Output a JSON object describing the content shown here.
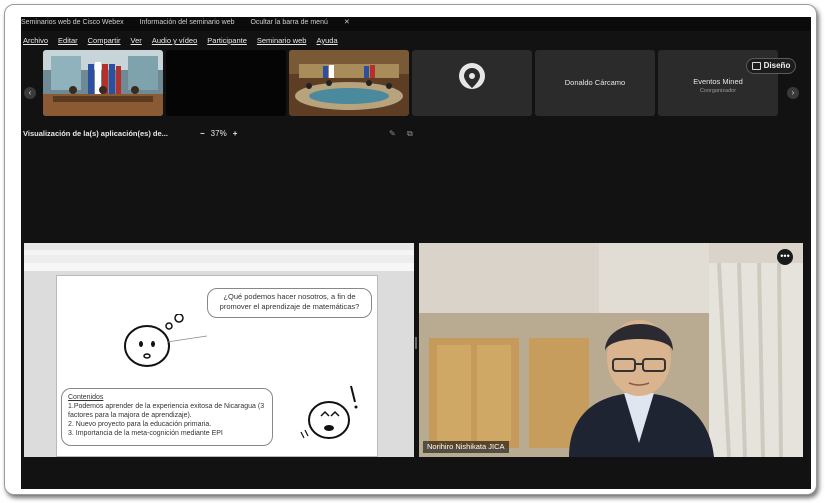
{
  "top_strip": {
    "items": [
      "Seminarios web de Cisco Webex",
      "Información del seminario web",
      "Ocultar la barra de menú"
    ],
    "close_glyph": "✕"
  },
  "menu": {
    "items": [
      "Archivo",
      "Editar",
      "Compartir",
      "Ver",
      "Audio y vídeo",
      "Participante",
      "Seminario web",
      "Ayuda"
    ]
  },
  "participants": {
    "tiles": [
      {
        "name": "Donaldo Cárcamo",
        "role": ""
      },
      {
        "name": "Eventos Mined",
        "role": "Coorganizador"
      }
    ],
    "layout_button": "Diseño",
    "avatar_icon": "location-pin-icon",
    "prev_icon": "chevron-left-icon",
    "next_icon": "chevron-right-icon"
  },
  "view": {
    "label": "Visualización de la(s) aplicación(es) de...",
    "zoom_minus": "−",
    "zoom_value": "37%",
    "zoom_plus": "+"
  },
  "slide": {
    "question": "¿Qué podemos hacer nosotros, a fin de promover el aprendizaje de matemáticas?",
    "contents_header": "Contenidos",
    "contents": [
      "1.Podemos aprender de la experiencia exitosa de Nicaragua (3 factores para la majora de aprendizaje).",
      "2. Nuevo proyecto para la educación primaria.",
      "3. Importancia de la meta-cognición mediante EPI"
    ]
  },
  "speaker": {
    "name": "Norihiro Nishikata JICA",
    "more_glyph": "•••"
  },
  "colors": {
    "screen_bg": "#121212",
    "tile_bg": "#2b2b2b"
  }
}
